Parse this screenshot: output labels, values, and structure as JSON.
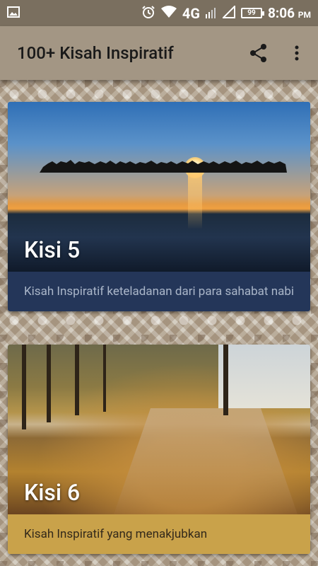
{
  "status_bar": {
    "network": "4G",
    "battery": "99",
    "time": "8:06",
    "ampm": "PM"
  },
  "app_bar": {
    "title": "100+ Kisah Inspiratif",
    "share_icon": "share-icon",
    "more_icon": "more-vert-icon"
  },
  "cards": [
    {
      "title": "Kisi 5",
      "description": "Kisah Inspiratif keteladanan dari para sahabat nabi",
      "color": "#243659"
    },
    {
      "title": "Kisi 6",
      "description": "Kisah Inspiratif yang menakjubkan",
      "color": "#c9a24a"
    }
  ]
}
